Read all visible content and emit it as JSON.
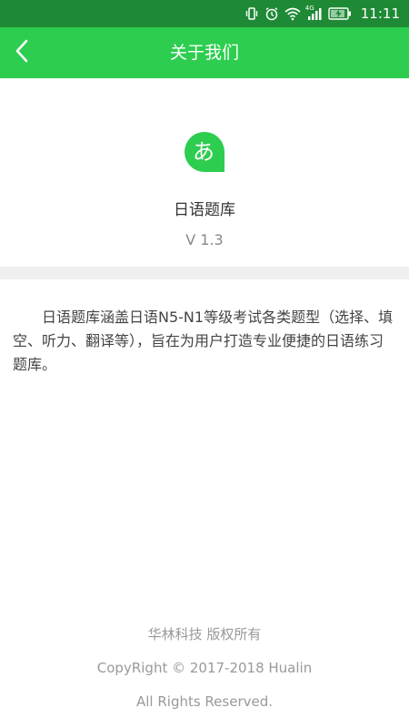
{
  "status_bar": {
    "time": "11:11",
    "network_label": "4G",
    "icons": [
      "vibrate-icon",
      "alarm-icon",
      "wifi-icon",
      "signal-icon",
      "battery-charging-icon"
    ]
  },
  "header": {
    "title": "关于我们",
    "back_icon": "chevron-left-icon"
  },
  "app": {
    "logo_glyph": "あ",
    "name": "日语题库",
    "version": "V 1.3"
  },
  "description": "日语题库涵盖日语N5-N1等级考试各类题型（选择、填空、听力、翻译等），旨在为用户打造专业便捷的日语练习题库。",
  "footer": {
    "company": "华林科技 版权所有",
    "copyright": "CopyRight © 2017-2018 Hualin",
    "rights": "All Rights Reserved."
  },
  "colors": {
    "status_bar": "#1f8a35",
    "header": "#2dcd50",
    "logo": "#2dcd50",
    "divider": "#efefef"
  }
}
